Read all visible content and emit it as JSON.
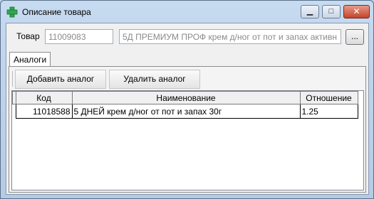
{
  "window": {
    "title": "Описание товара",
    "minimize_glyph": "▁",
    "maximize_glyph": "□",
    "close_glyph": "✕",
    "icon": "green-cross-icon"
  },
  "product": {
    "label": "Товар",
    "code": "11009083",
    "name": "5Д ПРЕМИУМ ПРОФ крем д/ног от пот и запах активн",
    "browse_label": "..."
  },
  "tabs": [
    {
      "label": "Аналоги",
      "active": true
    }
  ],
  "toolbar": {
    "add_label": "Добавить аналог",
    "delete_label": "Удалить аналог"
  },
  "grid": {
    "columns": [
      "Код",
      "Наименование",
      "Отношение"
    ],
    "rows": [
      {
        "code": "11018588",
        "name": "5 ДНЕЙ крем д/ног от пот и запах 30г",
        "ratio": "1.25"
      }
    ]
  },
  "colors": {
    "accent": "#2fa84f",
    "close": "#c4452c"
  }
}
